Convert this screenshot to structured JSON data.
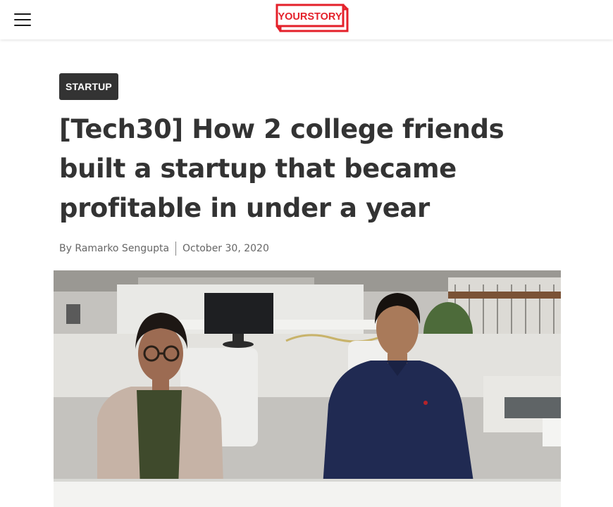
{
  "header": {
    "menu_icon": "hamburger-menu-icon",
    "logo_text": "YOURSTORY",
    "brand_color": "#e4202a"
  },
  "article": {
    "category": "STARTUP",
    "title": "[Tech30] How 2 college friends built a startup that became profitable in under a year",
    "author": "By Ramarko Sengupta",
    "date": "October 30, 2020"
  },
  "hero_image": {
    "description_icon": "founders-photo"
  }
}
